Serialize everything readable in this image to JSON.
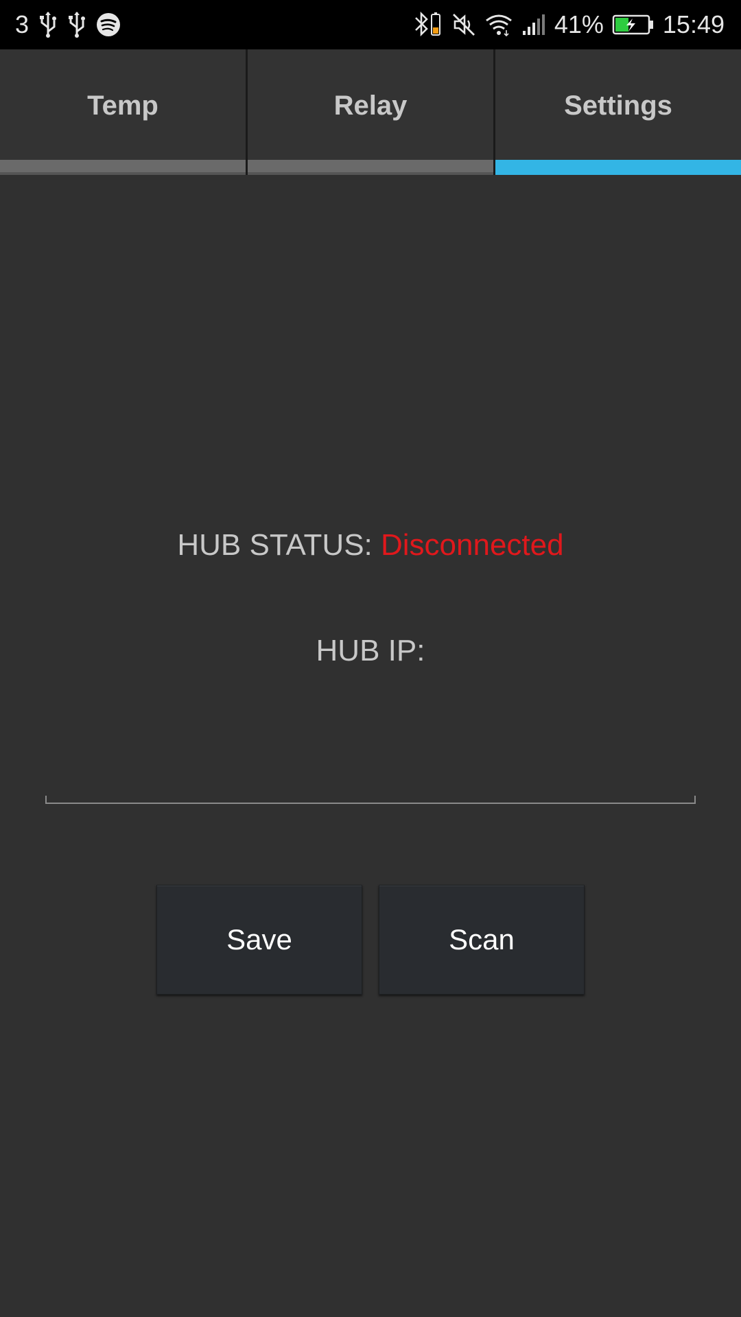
{
  "status_bar": {
    "carrier": "3",
    "battery_percent": "41%",
    "time": "15:49",
    "left_icons": [
      "usb-icon",
      "usb-icon",
      "spotify-icon"
    ],
    "right_icons": [
      "bluetooth-battery-icon",
      "mute-icon",
      "wifi-icon",
      "signal-icon",
      "battery-charging-icon"
    ],
    "battery_level": 0.41,
    "battery_color": "#2ecc40"
  },
  "tabs": [
    {
      "label": "Temp",
      "active": false
    },
    {
      "label": "Relay",
      "active": false
    },
    {
      "label": "Settings",
      "active": true
    }
  ],
  "accent_color": "#33b5e5",
  "hub": {
    "status_label": "HUB STATUS:",
    "status_value": "Disconnected",
    "status_color": "#e0181c",
    "ip_label": "HUB IP:",
    "ip_value": ""
  },
  "buttons": {
    "save_label": "Save",
    "scan_label": "Scan"
  }
}
